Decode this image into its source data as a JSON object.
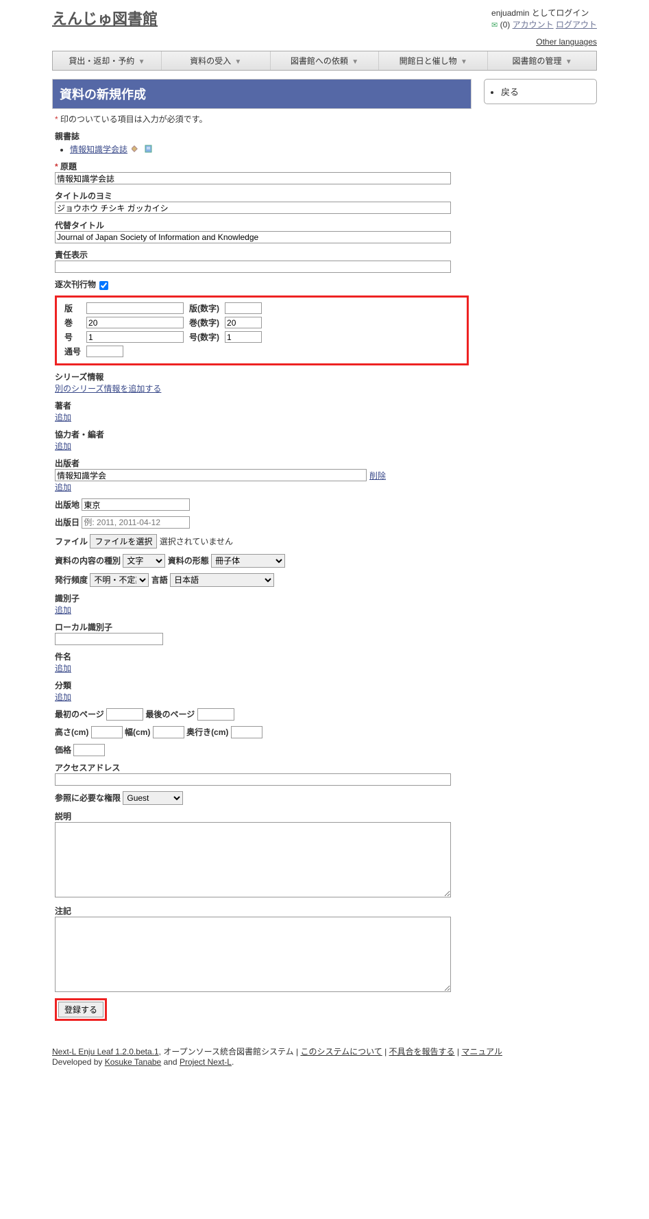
{
  "header": {
    "site_title": "えんじゅ図書館",
    "login_text": "enjuadmin としてログイン",
    "msg_count": "(0)",
    "account_link": "アカウント",
    "logout_link": "ログアウト",
    "other_lang": "Other languages"
  },
  "menu": [
    "貸出・返却・予約",
    "資料の受入",
    "図書館への依頼",
    "開館日と催し物",
    "図書館の管理"
  ],
  "side": {
    "back": "戻る"
  },
  "page": {
    "title": "資料の新規作成",
    "required_notice": "印のついている項目は入力が必須です。",
    "parent_label": "親書誌",
    "parent_item": "情報知識学会誌",
    "original_title_label": "原題",
    "original_title_value": "情報知識学会誌",
    "yomi_label": "タイトルのヨミ",
    "yomi_value": "ジョウホウ チシキ ガッカイシ",
    "alt_label": "代替タイトル",
    "alt_value": "Journal of Japan Society of Information and Knowledge",
    "resp_label": "責任表示",
    "serial_label": "逐次刊行物",
    "vol": {
      "edition": "版",
      "edition_num": "版(数字)",
      "volume": "巻",
      "volume_val": "20",
      "volume_num": "巻(数字)",
      "volume_num_val": "20",
      "issue": "号",
      "issue_val": "1",
      "issue_num": "号(数字)",
      "issue_num_val": "1",
      "serial_no": "通号"
    },
    "series_label": "シリーズ情報",
    "series_add": "別のシリーズ情報を追加する",
    "author_label": "著者",
    "add_link": "追加",
    "contrib_label": "協力者・編者",
    "publisher_label": "出版者",
    "publisher_value": "情報知識学会",
    "delete_link": "削除",
    "pubplace_label": "出版地",
    "pubplace_value": "東京",
    "pubdate_label": "出版日",
    "pubdate_placeholder": "例: 2011, 2011-04-12",
    "file_label": "ファイル",
    "file_btn": "ファイルを選択",
    "file_status": "選択されていません",
    "content_type_label": "資料の内容の種別",
    "content_type_value": "文字",
    "carrier_label": "資料の形態",
    "carrier_value": "冊子体",
    "freq_label": "発行頻度",
    "freq_value": "不明・不定期刊",
    "lang_label": "言語",
    "lang_value": "日本語",
    "identifier_label": "識別子",
    "local_id_label": "ローカル識別子",
    "subject_label": "件名",
    "classification_label": "分類",
    "first_page_label": "最初のページ",
    "last_page_label": "最後のページ",
    "height_label": "高さ(cm)",
    "width_label": "幅(cm)",
    "depth_label": "奥行き(cm)",
    "price_label": "価格",
    "access_label": "アクセスアドレス",
    "role_label": "参照に必要な権限",
    "role_value": "Guest",
    "desc_label": "説明",
    "note_label": "注記",
    "submit_btn": "登録する"
  },
  "footer": {
    "version": "Next-L Enju Leaf 1.2.0.beta.1",
    "oss": ", オープンソース統合図書館システム | ",
    "about": "このシステムについて",
    "sep": " | ",
    "report": "不具合を報告する",
    "manual": "マニュアル",
    "dev": "Developed by ",
    "dev1": "Kosuke Tanabe",
    "and": " and ",
    "dev2": "Project Next-L",
    "period": "."
  }
}
